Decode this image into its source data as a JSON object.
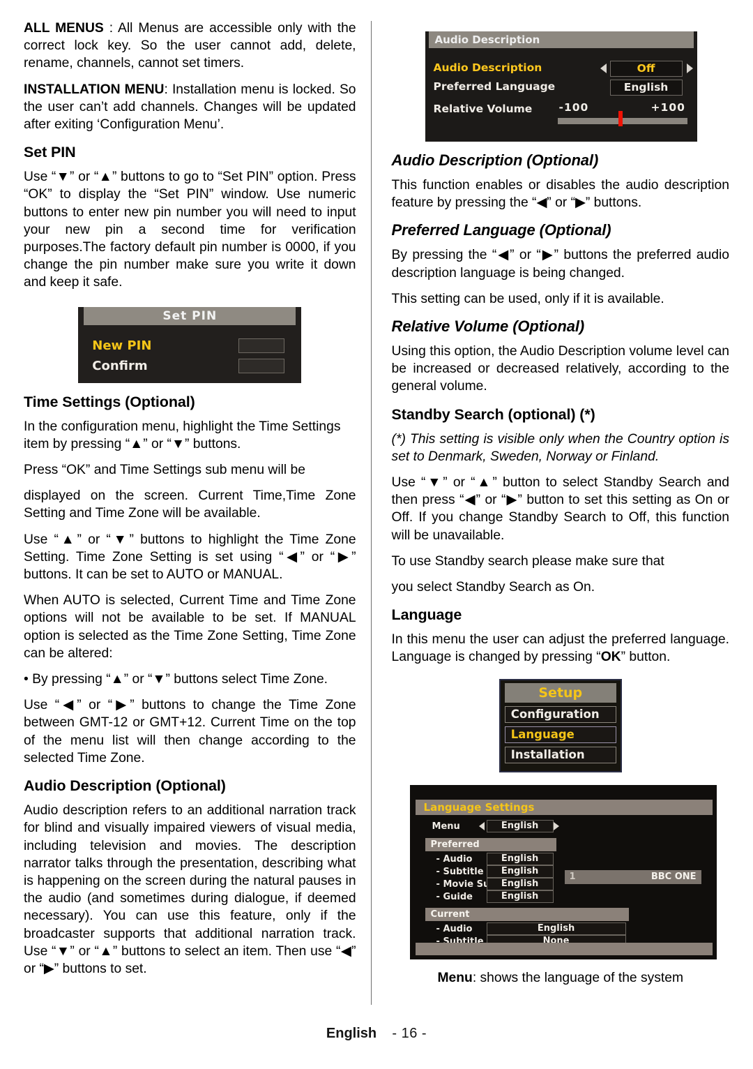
{
  "left_column": {
    "para_all_menus": {
      "bold": "ALL MENUS",
      "rest": " : All  Menus are  accessible only with the correct lock key. So the user cannot add, delete, rename, channels, cannot set timers."
    },
    "para_installation_menu": {
      "bold": "INSTALLATION MENU",
      "rest": ": Installation menu is locked. So the user can’t add channels. Changes will be updated after exiting ‘Configuration Menu’."
    },
    "heading_set_pin": "Set PIN",
    "para_set_pin_a": "Use “▼” or “▲” buttons to go to “Set PIN” option. Press “OK” to display the “Set PIN” window. Use numeric buttons to enter new pin number you will need to input your new pin a second time for verification purposes.The factory default pin number is 0000, if you change the pin number make sure you write it down and keep it safe.",
    "heading_time_settings": "Time Settings (Optional)",
    "para_time_a": "In the configuration menu, highlight the Time Settings item by pressing “▲” or “▼” buttons.",
    "para_time_b": "Press “OK” and Time Settings sub menu will be",
    "para_time_c": "displayed on the screen. Current Time,Time Zone Setting and Time Zone will be available.",
    "para_time_d": "Use “▲” or “▼” buttons to highlight the Time Zone Setting. Time Zone Setting is set using “◀” or “▶” buttons. It can be set to AUTO or MANUAL.",
    "para_time_e": "When AUTO is selected, Current Time and Time Zone options will not be available to be set. If MANUAL option is selected as the Time Zone Setting, Time Zone can be altered:",
    "para_time_f": "• By pressing “▲” or “▼” buttons select Time Zone.",
    "para_time_g": "Use “◀” or “▶” buttons to change the Time Zone between GMT-12 or GMT+12. Current Time on the top of the menu list will then change according to the selected Time Zone.",
    "heading_audio_description": "Audio Description (Optional)",
    "para_audio_description": "Audio description refers to an additional narration track for blind and visually impaired viewers of visual media, including television and movies. The description narrator talks through the presentation, describing what is happening on the screen during the natural pauses in the audio (and sometimes during dialogue, if deemed necessary). You can use this feature, only if the broadcaster supports that additional narration track. Use “▼” or “▲” buttons to select an item. Then use “◀” or “▶” buttons to set."
  },
  "right_column": {
    "heading_audio_description": "Audio Description (Optional)",
    "para_audio_description": "This function enables or disables the audio description feature by pressing the “◀” or “▶” buttons.",
    "heading_preferred_language": "Preferred Language (Optional)",
    "para_preferred_language_a": "By pressing the “◀” or “▶” buttons the preferred audio description language is being changed.",
    "para_preferred_language_b": "This setting can be used, only if it is available.",
    "heading_relative_volume": "Relative Volume (Optional)",
    "para_relative_volume": "Using this option, the Audio Description volume level can be increased or decreased relatively, according to the general volume.",
    "heading_standby_search": "Standby Search (optional) (*)",
    "para_standby_note": "(*) This setting is visible only when the Country option is set to Denmark, Sweden, Norway or Finland.",
    "para_standby_a": "Use “▼” or “▲” button to select Standby Search and then press “◀” or “▶” button to set this setting as On or Off. If you change Standby Search to Off, this function will be unavailable.",
    "para_standby_b": "To use Standby search please make sure that",
    "para_standby_c": "you select Standby Search as On.",
    "heading_language": "Language",
    "para_language": {
      "a": "In this menu the user can adjust the preferred language. Language is changed by pressing “",
      "bold": "OK",
      "b": "” button."
    },
    "caption_menu": {
      "bold": "Menu",
      "rest": ": shows the language of the system"
    }
  },
  "osd_audio_description": {
    "title": "Audio Description",
    "row_audio_description_label": "Audio Description",
    "row_audio_description_value": "Off",
    "row_preferred_language_label": "Preferred Language",
    "row_preferred_language_value": "English",
    "row_relative_volume_label": "Relative Volume",
    "volume_min": "-100",
    "volume_max": "+100",
    "highlight_color": "#ffc81e",
    "slider_knob_color": "#f01205"
  },
  "osd_set_pin": {
    "title": "Set PIN",
    "new_pin_label": "New PIN",
    "new_pin_value": "",
    "confirm_label": "Confirm",
    "confirm_value": "",
    "highlight_color": "#f5c518"
  },
  "osd_setup": {
    "title": "Setup",
    "items": [
      {
        "label": "Configuration",
        "selected": false
      },
      {
        "label": "Language",
        "selected": true
      },
      {
        "label": "Installation",
        "selected": false
      }
    ],
    "highlight_color": "#f5c518"
  },
  "osd_language_settings": {
    "title": "Language Settings",
    "menu_label": "Menu",
    "menu_value": "English",
    "section_preferred": "Preferred",
    "preferred_rows": [
      {
        "label": "- Audio",
        "value": "English"
      },
      {
        "label": "- Subtitle",
        "value": "English"
      },
      {
        "label": "- Movie Subt.",
        "value": "English"
      },
      {
        "label": "- Guide",
        "value": "English"
      }
    ],
    "section_current": "Current",
    "current_rows": [
      {
        "label": "- Audio",
        "value": "English"
      },
      {
        "label": "- Subtitle",
        "value": "None"
      }
    ],
    "channel_number": "1",
    "channel_name": "BBC ONE",
    "highlight_color": "#f5c518"
  },
  "footer": {
    "language": "English",
    "page": "- 16 -"
  }
}
